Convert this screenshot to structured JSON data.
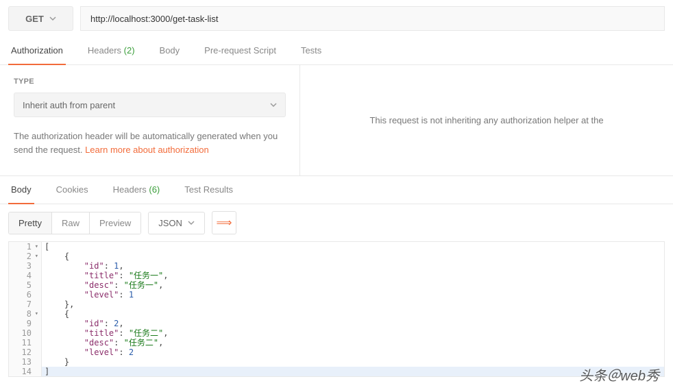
{
  "request": {
    "method": "GET",
    "url": "http://localhost:3000/get-task-list"
  },
  "requestTabs": [
    {
      "label": "Authorization",
      "active": true
    },
    {
      "label": "Headers",
      "count": "(2)",
      "active": false
    },
    {
      "label": "Body",
      "active": false
    },
    {
      "label": "Pre-request Script",
      "active": false
    },
    {
      "label": "Tests",
      "active": false
    }
  ],
  "auth": {
    "typeLabel": "TYPE",
    "selected": "Inherit auth from parent",
    "desc1": "The authorization header will be automatically generated when you send the request. ",
    "learnMore": "Learn more about authorization",
    "rightMsg": "This request is not inheriting any authorization helper at the"
  },
  "responseTabs": [
    {
      "label": "Body",
      "active": true
    },
    {
      "label": "Cookies",
      "active": false
    },
    {
      "label": "Headers",
      "count": "(6)",
      "active": false
    },
    {
      "label": "Test Results",
      "active": false
    }
  ],
  "viewModes": [
    {
      "label": "Pretty",
      "active": true
    },
    {
      "label": "Raw",
      "active": false
    },
    {
      "label": "Preview",
      "active": false
    }
  ],
  "format": "JSON",
  "codeLines": [
    {
      "n": "1",
      "fold": true,
      "tokens": [
        {
          "t": "[",
          "c": "p"
        }
      ]
    },
    {
      "n": "2",
      "fold": true,
      "tokens": [
        {
          "t": "    ",
          "c": ""
        },
        {
          "t": "{",
          "c": "p"
        }
      ]
    },
    {
      "n": "3",
      "tokens": [
        {
          "t": "        ",
          "c": ""
        },
        {
          "t": "\"id\"",
          "c": "k"
        },
        {
          "t": ": ",
          "c": "p"
        },
        {
          "t": "1",
          "c": "n"
        },
        {
          "t": ",",
          "c": "p"
        }
      ]
    },
    {
      "n": "4",
      "tokens": [
        {
          "t": "        ",
          "c": ""
        },
        {
          "t": "\"title\"",
          "c": "k"
        },
        {
          "t": ": ",
          "c": "p"
        },
        {
          "t": "\"任务一\"",
          "c": "s"
        },
        {
          "t": ",",
          "c": "p"
        }
      ]
    },
    {
      "n": "5",
      "tokens": [
        {
          "t": "        ",
          "c": ""
        },
        {
          "t": "\"desc\"",
          "c": "k"
        },
        {
          "t": ": ",
          "c": "p"
        },
        {
          "t": "\"任务一\"",
          "c": "s"
        },
        {
          "t": ",",
          "c": "p"
        }
      ]
    },
    {
      "n": "6",
      "tokens": [
        {
          "t": "        ",
          "c": ""
        },
        {
          "t": "\"level\"",
          "c": "k"
        },
        {
          "t": ": ",
          "c": "p"
        },
        {
          "t": "1",
          "c": "n"
        }
      ]
    },
    {
      "n": "7",
      "tokens": [
        {
          "t": "    ",
          "c": ""
        },
        {
          "t": "},",
          "c": "p"
        }
      ]
    },
    {
      "n": "8",
      "fold": true,
      "tokens": [
        {
          "t": "    ",
          "c": ""
        },
        {
          "t": "{",
          "c": "p"
        }
      ]
    },
    {
      "n": "9",
      "tokens": [
        {
          "t": "        ",
          "c": ""
        },
        {
          "t": "\"id\"",
          "c": "k"
        },
        {
          "t": ": ",
          "c": "p"
        },
        {
          "t": "2",
          "c": "n"
        },
        {
          "t": ",",
          "c": "p"
        }
      ]
    },
    {
      "n": "10",
      "tokens": [
        {
          "t": "        ",
          "c": ""
        },
        {
          "t": "\"title\"",
          "c": "k"
        },
        {
          "t": ": ",
          "c": "p"
        },
        {
          "t": "\"任务二\"",
          "c": "s"
        },
        {
          "t": ",",
          "c": "p"
        }
      ]
    },
    {
      "n": "11",
      "tokens": [
        {
          "t": "        ",
          "c": ""
        },
        {
          "t": "\"desc\"",
          "c": "k"
        },
        {
          "t": ": ",
          "c": "p"
        },
        {
          "t": "\"任务二\"",
          "c": "s"
        },
        {
          "t": ",",
          "c": "p"
        }
      ]
    },
    {
      "n": "12",
      "tokens": [
        {
          "t": "        ",
          "c": ""
        },
        {
          "t": "\"level\"",
          "c": "k"
        },
        {
          "t": ": ",
          "c": "p"
        },
        {
          "t": "2",
          "c": "n"
        }
      ]
    },
    {
      "n": "13",
      "tokens": [
        {
          "t": "    ",
          "c": ""
        },
        {
          "t": "}",
          "c": "p"
        }
      ]
    },
    {
      "n": "14",
      "hl": true,
      "tokens": [
        {
          "t": "]",
          "c": "p"
        }
      ]
    }
  ],
  "watermark": "头条＠web秀"
}
